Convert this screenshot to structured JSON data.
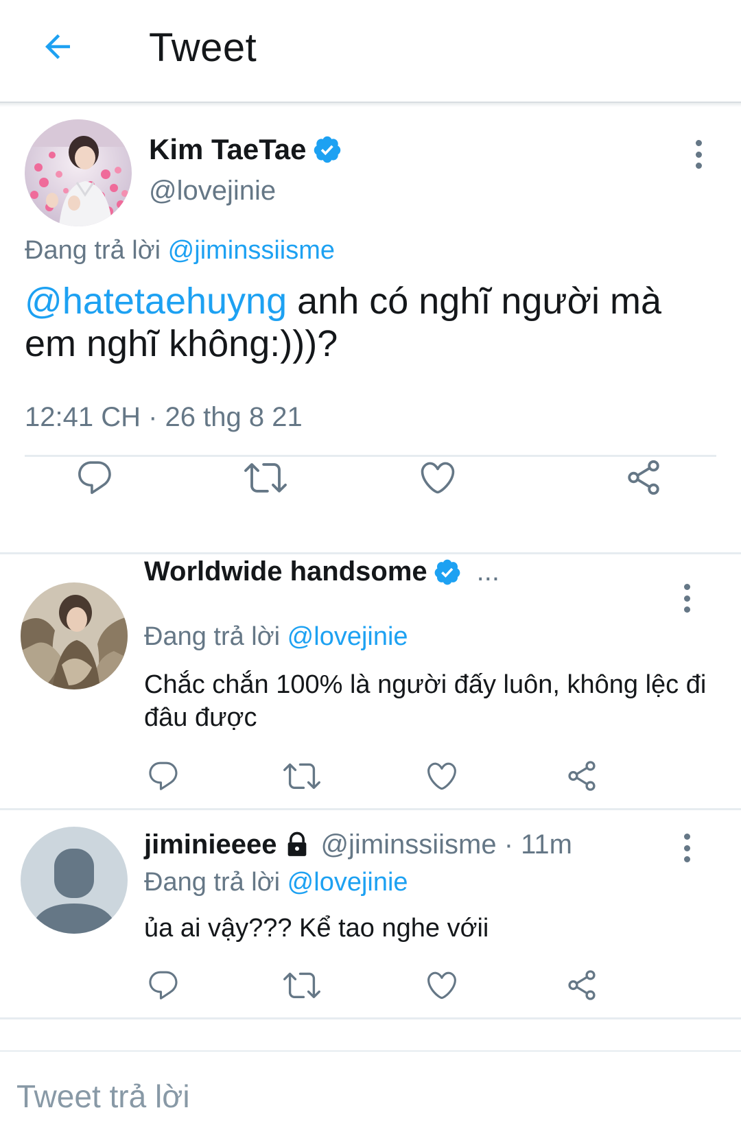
{
  "header": {
    "title": "Tweet",
    "back_icon": "arrow-left-icon",
    "accent": "#1da1f2"
  },
  "main_tweet": {
    "display_name": "Kim TaeTae",
    "verified": true,
    "handle": "@lovejinie",
    "replying_prefix": "Đang trả lời",
    "replying_to": "@jiminssiisme",
    "mention": "@hatetaehuyng",
    "text_rest": " anh có nghĩ người mà em nghĩ không:)))?",
    "timestamp": "12:41 CH · 26 thg 8 21",
    "actions": [
      "reply-icon",
      "retweet-icon",
      "like-icon",
      "share-icon"
    ]
  },
  "replies": [
    {
      "display_name": "Worldwide handsome",
      "verified": true,
      "meta": "...",
      "replying_prefix": "Đang trả lời",
      "replying_to": "@lovejinie",
      "text": "Chắc chắn 100% là người đấy luôn, không lệc đi đâu được"
    },
    {
      "display_name": "jiminieeee",
      "protected": true,
      "meta": "@jiminssiisme · 11m",
      "replying_prefix": "Đang trả lời",
      "replying_to": "@lovejinie",
      "text": "ủa ai vậy??? Kể tao nghe vớii"
    }
  ],
  "compose": {
    "placeholder": "Tweet trả lời"
  },
  "colors": {
    "text": "#14171a",
    "secondary": "#657786",
    "link": "#1da1f2",
    "divider": "#e6ecf0"
  }
}
